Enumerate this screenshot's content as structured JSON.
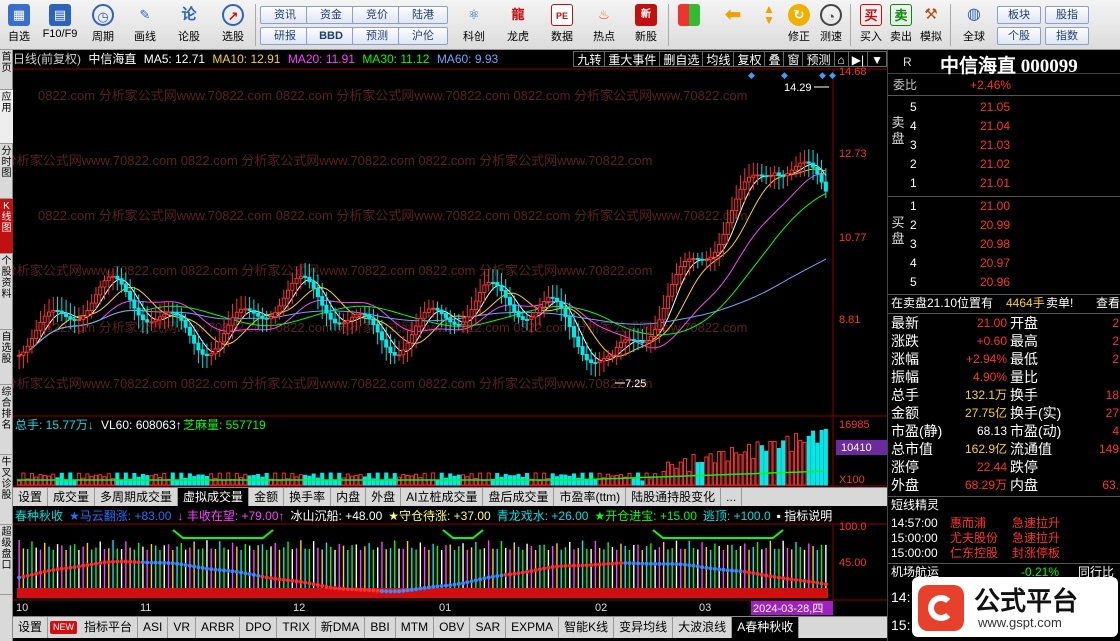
{
  "toolbar": {
    "items": [
      {
        "label": "自选",
        "icon": "grid-icon"
      },
      {
        "label": "F10/F9",
        "icon": "doc-icon"
      },
      {
        "label": "周期",
        "icon": "clock-icon"
      },
      {
        "label": "画线",
        "icon": "pen-icon"
      },
      {
        "label": "论股",
        "icon": "chat-icon"
      },
      {
        "label": "选股",
        "icon": "target-icon"
      }
    ],
    "buttons_row1": [
      "资讯",
      "资金",
      "竞价",
      "陆港"
    ],
    "buttons_row2": [
      "研报",
      "BBD",
      "预测",
      "沪伦"
    ],
    "items2": [
      {
        "label": "科创",
        "icon": "science-icon"
      },
      {
        "label": "龙虎",
        "icon": "dragon-icon"
      },
      {
        "label": "数据",
        "icon": "pe-icon"
      },
      {
        "label": "热点",
        "icon": "fire-icon"
      },
      {
        "label": "新股",
        "icon": "newstock-icon"
      }
    ],
    "items3": [
      {
        "label": "",
        "icon": "color-grid-icon"
      },
      {
        "label": "",
        "icon": "arrow-left-icon"
      },
      {
        "label": "",
        "icon": "arrow-up-down-icon"
      },
      {
        "label": "修正",
        "icon": "fix-icon"
      },
      {
        "label": "测速",
        "icon": "speed-icon"
      }
    ],
    "trade": [
      {
        "label": "买入",
        "icon": "buy-icon",
        "glyph": "买"
      },
      {
        "label": "卖出",
        "icon": "sell-icon",
        "glyph": "卖"
      },
      {
        "label": "模拟",
        "icon": "hammer-icon",
        "glyph": ""
      }
    ],
    "global": {
      "label": "全球",
      "icon": "globe-icon"
    },
    "buttons_right_row1": [
      "板块",
      "股指"
    ],
    "buttons_right_row2": [
      "个股",
      "指数"
    ]
  },
  "left_tabs": [
    "首页",
    "应用",
    "分时图",
    "K线图",
    "个股资料",
    "自选股",
    "综合排名",
    "牛叉诊股",
    "超级盘口"
  ],
  "info_bar": {
    "period": "日线(前复权)",
    "stock": "中信海直",
    "ma5": "MA5: 12.71",
    "ma10": "MA10: 12.91",
    "ma20": "MA20: 11.91",
    "ma30": "MA30: 11.12",
    "ma60": "MA60: 9.93"
  },
  "tool_tabs": [
    "九转",
    "重大事件",
    "删自选",
    "均线",
    "复权",
    "叠",
    "窗",
    "预测",
    "⌂",
    "▶|",
    "▼"
  ],
  "price_axis": [
    "14.68",
    "12.73",
    "10.77",
    "8.81"
  ],
  "annotations": {
    "high": "14.29",
    "low": "7.25"
  },
  "watermark": "0822.com 分析家公式网www.70822.com",
  "volume_info": {
    "total": "总手: 15.77万↓",
    "vl60": "VL60: 608063↑",
    "zhima": "芝麻量: 557719"
  },
  "volume_axis": [
    "16985",
    "10410",
    "X100"
  ],
  "vol_tabs": [
    "设置",
    "成交量",
    "多周期成交量",
    "虚拟成交量",
    "金额",
    "换手率",
    "内盘",
    "外盘",
    "AI立桩成交量",
    "盘后成交量",
    "市盈率(ttm)",
    "陆股通持股变化",
    "..."
  ],
  "vol_tab_active": 3,
  "indicator_bar": [
    {
      "text": "春种秋收",
      "color": "#00e0e0"
    },
    {
      "text": "★马云翻涨: +83.00",
      "color": "#2a6cff"
    },
    {
      "text": "↓ 丰收在望: +79.00↑",
      "color": "#ff40ff"
    },
    {
      "text": "冰山沉船: +48.00",
      "color": "#ffffff"
    },
    {
      "text": "★守仓待涨: +37.00",
      "color": "#ffff60"
    },
    {
      "text": "青龙戏水: +26.00",
      "color": "#00e0e0"
    },
    {
      "text": "★开仓进宝: +15.00",
      "color": "#00ff00"
    },
    {
      "text": "逃顶: +100.0",
      "color": "#00e0e0"
    },
    {
      "text": "▪ 指标说明",
      "color": "#ffffff"
    }
  ],
  "indicator_axis": [
    "100.0",
    "45.00"
  ],
  "date_axis": [
    "10",
    "11",
    "12",
    "01",
    "02",
    "03"
  ],
  "date_cursor": "2024-03-28,四",
  "bottom_tabs": [
    "设置",
    "NEW",
    "指标平台",
    "ASI",
    "VR",
    "ARBR",
    "DPO",
    "TRIX",
    "新DMA",
    "BBI",
    "MTM",
    "OBV",
    "SAR",
    "EXPMA",
    "智能K线",
    "变异均线",
    "大波浪线",
    "A春种秋收"
  ],
  "panel": {
    "r": "R",
    "name": "中信海直",
    "code": "000099",
    "weibi_label": "委比",
    "weibi": "+2.46%",
    "sell_label": "卖盘",
    "buy_label": "买盘",
    "sell": [
      {
        "lvl": "5",
        "price": "21.05"
      },
      {
        "lvl": "4",
        "price": "21.04"
      },
      {
        "lvl": "3",
        "price": "21.03"
      },
      {
        "lvl": "2",
        "price": "21.02"
      },
      {
        "lvl": "1",
        "price": "21.01"
      }
    ],
    "buy": [
      {
        "lvl": "1",
        "price": "21.00"
      },
      {
        "lvl": "2",
        "price": "20.99"
      },
      {
        "lvl": "3",
        "price": "20.98"
      },
      {
        "lvl": "4",
        "price": "20.97"
      },
      {
        "lvl": "5",
        "price": "20.96"
      }
    ],
    "status_line": {
      "a": "在卖盘21.10位置有",
      "b": "4464手",
      "c": "卖单!",
      "d": "查看"
    },
    "stats": [
      {
        "l": "最新",
        "v": "21.00",
        "vc": "red",
        "l2": "开盘",
        "v2": "2"
      },
      {
        "l": "涨跌",
        "v": "+0.60",
        "vc": "red",
        "l2": "最高",
        "v2": "2"
      },
      {
        "l": "涨幅",
        "v": "+2.94%",
        "vc": "red",
        "l2": "最低",
        "v2": "2"
      },
      {
        "l": "振幅",
        "v": "4.90%",
        "vc": "red",
        "l2": "量比",
        "v2": ""
      },
      {
        "l": "总手",
        "v": "132.1万",
        "vc": "yellow",
        "l2": "换手",
        "v2": "18"
      },
      {
        "l": "金额",
        "v": "27.75亿",
        "vc": "yellow",
        "l2": "换手(实)",
        "v2": "27"
      },
      {
        "l": "市盈(静)",
        "v": "68.13",
        "vc": "white",
        "l2": "市盈(动)",
        "v2": "4"
      },
      {
        "l": "总市值",
        "v": "162.9亿",
        "vc": "yellow",
        "l2": "流通值",
        "v2": "149"
      },
      {
        "l": "涨停",
        "v": "22.44",
        "vc": "red",
        "l2": "跌停",
        "v2": ""
      },
      {
        "l": "外盘",
        "v": "68.29万",
        "vc": "red",
        "l2": "内盘",
        "v2": "63."
      }
    ],
    "elves_title": "短线精灵",
    "elves": [
      {
        "time": "14:57:00",
        "name": "惠而浦",
        "event": "急速拉升"
      },
      {
        "time": "15:00:00",
        "name": "尤夫股份",
        "event": "急速拉升"
      },
      {
        "time": "15:00:00",
        "name": "仁东控股",
        "event": "封涨停板"
      }
    ],
    "airport": {
      "label": "机场航运",
      "value": "-0.21%",
      "extra": "同行比"
    },
    "time_partial": "14:",
    "time_partial2": "15:"
  },
  "logo": {
    "text": "公式平台",
    "url": "www.gspt.com"
  }
}
